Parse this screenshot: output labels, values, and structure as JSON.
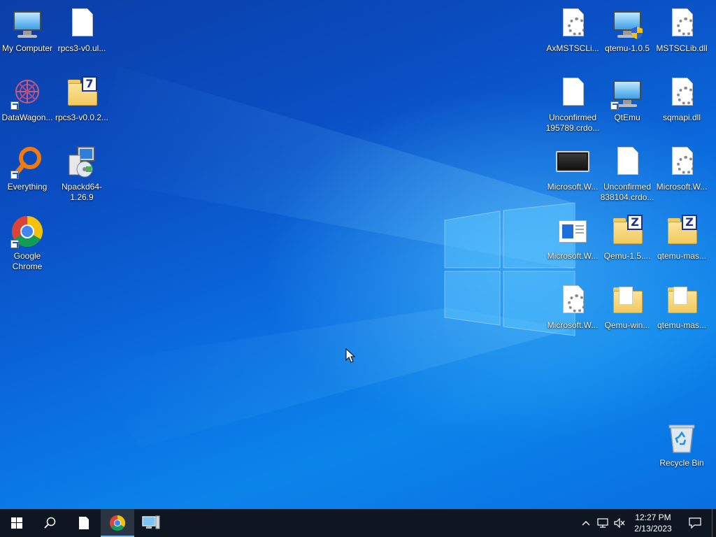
{
  "desktop": {
    "icons_left": [
      {
        "label": "My Computer",
        "type": "computer"
      },
      {
        "label": "rpcs3-v0.ul...",
        "type": "file"
      },
      {
        "label": "DataWagon...",
        "type": "app-shortcut"
      },
      {
        "label": "rpcs3-v0.0.2...",
        "type": "7z-archive"
      },
      {
        "label": "Everything",
        "type": "app-shortcut"
      },
      {
        "label": "Npackd64-1.26.9",
        "type": "installer"
      },
      {
        "label": "Google Chrome",
        "type": "chrome-shortcut"
      }
    ],
    "icons_right": [
      {
        "label": "AxMSTSCLi...",
        "type": "dll"
      },
      {
        "label": "qtemu-1.0.5",
        "type": "installer"
      },
      {
        "label": "MSTSCLib.dll",
        "type": "dll"
      },
      {
        "label": "Unconfirmed 195789.crdo...",
        "type": "file"
      },
      {
        "label": "QtEmu",
        "type": "computer-shortcut"
      },
      {
        "label": "sqmapi.dll",
        "type": "dll"
      },
      {
        "label": "Microsoft.W...",
        "type": "tablet"
      },
      {
        "label": "Unconfirmed 838104.crdo...",
        "type": "file"
      },
      {
        "label": "Microsoft.W...",
        "type": "dll"
      },
      {
        "label": "Microsoft.W...",
        "type": "app-window"
      },
      {
        "label": "Qemu-1.5....",
        "type": "zip-archive"
      },
      {
        "label": "qtemu-mas...",
        "type": "zip-archive"
      },
      {
        "label": "Microsoft.W...",
        "type": "dll"
      },
      {
        "label": "Qemu-win...",
        "type": "folder"
      },
      {
        "label": "qtemu-mas...",
        "type": "folder"
      }
    ],
    "recycle_bin": {
      "label": "Recycle Bin"
    }
  },
  "taskbar": {
    "items": [
      {
        "name": "start-button",
        "icon": "windows-logo-icon"
      },
      {
        "name": "search-button",
        "icon": "search-icon"
      },
      {
        "name": "file-button",
        "icon": "document-icon"
      },
      {
        "name": "chrome-taskbar-button",
        "icon": "chrome-icon",
        "active": true
      },
      {
        "name": "computer-taskbar-button",
        "icon": "computer-icon"
      }
    ],
    "clock": {
      "time": "12:27 PM",
      "date": "2/13/2023"
    }
  },
  "colors": {
    "taskbar_bg": "#0e1621",
    "desktop_blue": "#0a6ddf",
    "active_indicator": "#76b9ed"
  }
}
